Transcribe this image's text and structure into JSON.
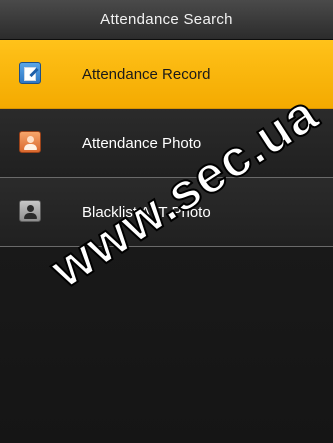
{
  "header": {
    "title": "Attendance Search"
  },
  "menu": {
    "items": [
      {
        "label": "Attendance Record",
        "icon": "edit-record-icon",
        "active": true
      },
      {
        "label": "Attendance Photo",
        "icon": "person-photo-icon",
        "active": false
      },
      {
        "label": "Blacklist ATT Photo",
        "icon": "blacklist-person-icon",
        "active": false
      }
    ]
  },
  "watermark": {
    "text": "www.sec.ua"
  },
  "colors": {
    "highlight": "#f4aa00",
    "background": "#1b1b1b",
    "titlebar": "#3a3a3a"
  }
}
